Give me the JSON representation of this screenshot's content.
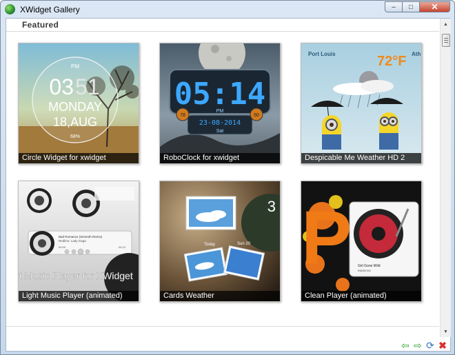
{
  "window": {
    "title": "XWidget Gallery",
    "minimize": "–",
    "maximize": "□",
    "close": "✕"
  },
  "section": {
    "title": "Featured"
  },
  "cards": [
    {
      "caption": "Circle Widget for xwidget",
      "hour": "03",
      "minute": "51",
      "ampm": "PM",
      "weekday": "MONDAY",
      "date": "18,AUG",
      "percent": "68%"
    },
    {
      "caption": "RoboClock for xwidget",
      "time": "05:14",
      "ampm": "PM",
      "date": "23-08-2014",
      "weekday": "Sat",
      "left_badge": "78",
      "right_badge": "50"
    },
    {
      "caption": "Despicable Me Weather HD 2",
      "city": "Port Louis",
      "city2": "Ath",
      "temp": "72°F"
    },
    {
      "caption": "Light Music Player (animated)",
      "title_text": "Light Music Player for XWidget",
      "track1": "Bad Romance (Seventh Remix)",
      "track2": "Redline: Lady Gaga",
      "time1": "00:00",
      "time2": "04:13"
    },
    {
      "caption": "Cards Weather",
      "big_num": "3",
      "today": "Today",
      "day2": "Sun 20"
    },
    {
      "caption": "Clean Player (animated)",
      "song": "Girl Gone Wild",
      "artist": "Madonna",
      "letter": "P"
    }
  ],
  "scrollbar": {
    "up": "▲",
    "down": "▼"
  },
  "bottom_icons": {
    "back": "⇦",
    "forward": "⇨",
    "refresh": "⟳",
    "close": "✖"
  }
}
